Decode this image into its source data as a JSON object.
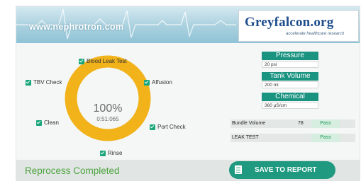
{
  "header": {
    "site_url": "www.nephrotron.com",
    "logo_text": "Greyfalcon.org",
    "logo_tagline": "accelerate healthcare research",
    "background_color": "#a9d0de"
  },
  "progress": {
    "percent_label": "100%",
    "elapsed": "0:51:065",
    "ring_color": "#f2b21a",
    "percent_value": 100
  },
  "steps": [
    {
      "label": "Blood Leak Test"
    },
    {
      "label": "Affusion"
    },
    {
      "label": "Port Check"
    },
    {
      "label": "Rinse"
    },
    {
      "label": "Clean"
    },
    {
      "label": "TBV Check"
    }
  ],
  "parameters": [
    {
      "name": "Pressure",
      "value": "20 psi"
    },
    {
      "name": "Tank Volume",
      "value": "200 ml"
    },
    {
      "name": "Chemical",
      "value": "360 μS/cm"
    }
  ],
  "results": [
    {
      "name": "Bundle Volume",
      "value": "78",
      "status": "Pass"
    },
    {
      "name": "LEAK TEST",
      "value": "",
      "status": "Pass"
    }
  ],
  "footer": {
    "status_message": "Reprocess Completed",
    "report_button_label": "SAVE TO REPORT",
    "accent_color": "#1f9a80",
    "success_color": "#4da43f"
  }
}
